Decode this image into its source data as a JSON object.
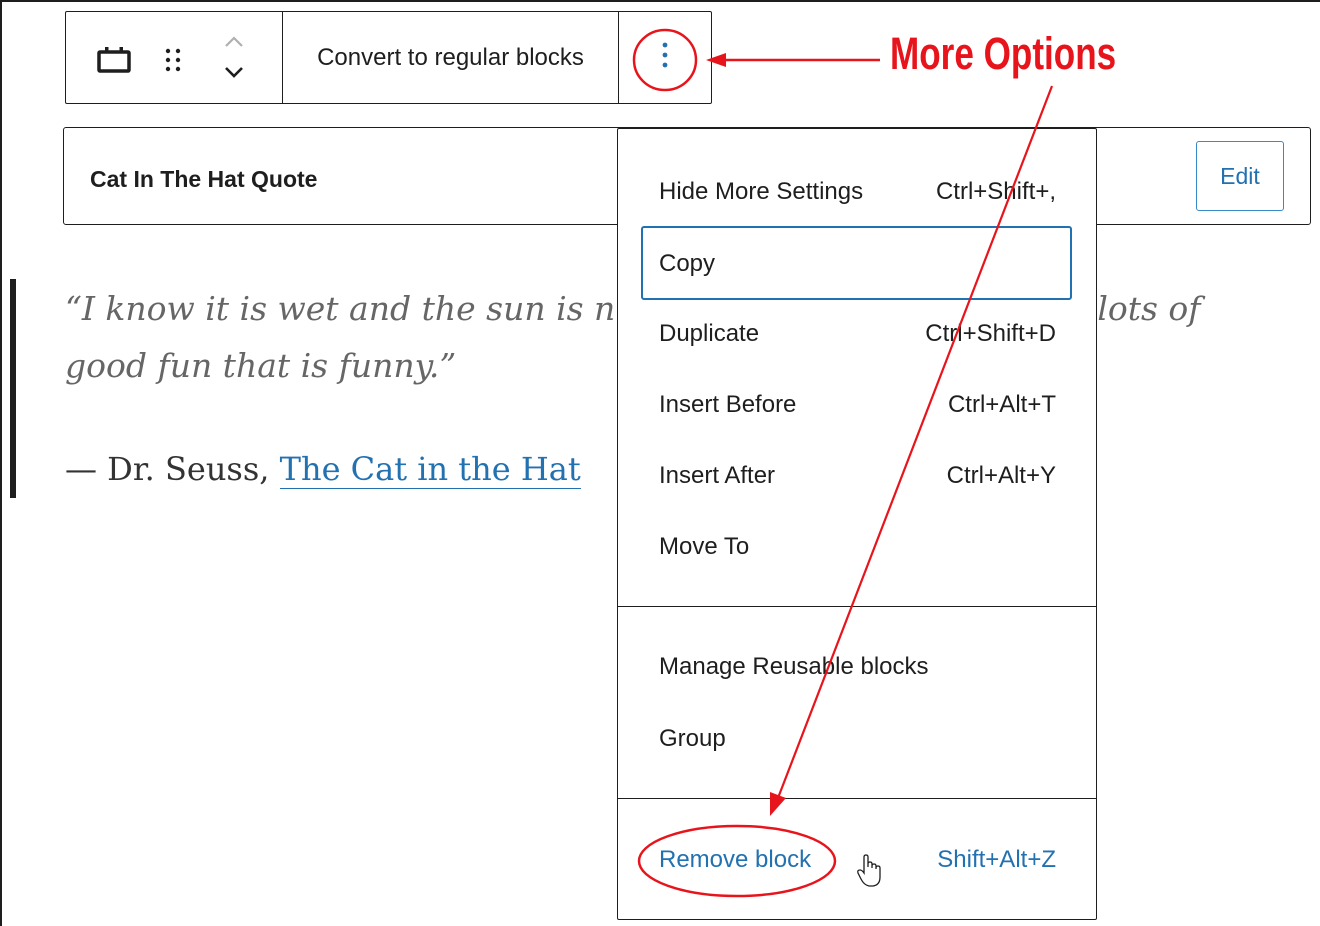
{
  "toolbar": {
    "convert_label": "Convert to regular blocks",
    "icons": [
      "reusable-block-icon",
      "drag-handle-icon",
      "chevron-up-icon",
      "chevron-down-icon",
      "more-vertical-icon"
    ]
  },
  "reusable_block": {
    "title": "Cat In The Hat Quote",
    "edit_label": "Edit"
  },
  "quote": {
    "text": "“I know it is wet and the sun is not sunny, but we can have lots of good fun that is funny.”",
    "visible_line1": "“I know it is wet and the sun is n",
    "visible_line1_tail": "lots of",
    "visible_line2": "good fun that is funny.”",
    "cite_prefix": "— Dr. Seuss, ",
    "cite_link": "The Cat in the Hat"
  },
  "menu": {
    "items": [
      {
        "label": "Hide More Settings",
        "shortcut": "Ctrl+Shift+,"
      },
      {
        "label": "Copy",
        "shortcut": ""
      },
      {
        "label": "Duplicate",
        "shortcut": "Ctrl+Shift+D"
      },
      {
        "label": "Insert Before",
        "shortcut": "Ctrl+Alt+T"
      },
      {
        "label": "Insert After",
        "shortcut": "Ctrl+Alt+Y"
      },
      {
        "label": "Move To",
        "shortcut": ""
      }
    ],
    "group2": [
      {
        "label": "Manage Reusable blocks"
      },
      {
        "label": "Group"
      }
    ],
    "remove": {
      "label": "Remove block",
      "shortcut": "Shift+Alt+Z"
    }
  },
  "annotation": {
    "label": "More Options",
    "color": "#e8141c"
  },
  "colors": {
    "accent": "#2271b1",
    "annotation": "#e8141c"
  }
}
